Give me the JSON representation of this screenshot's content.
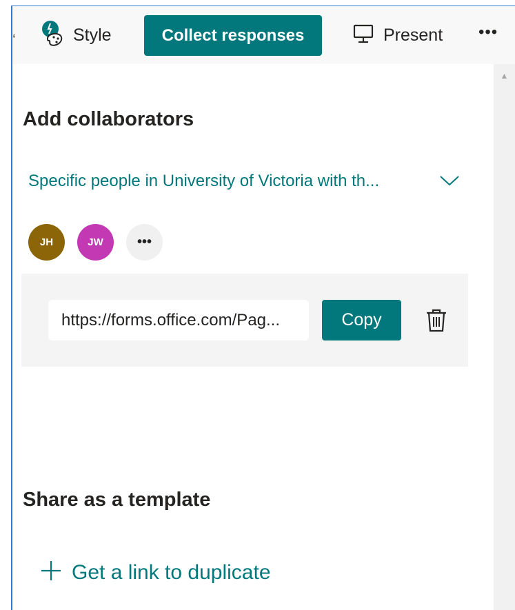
{
  "toolbar": {
    "style_label": "Style",
    "collect_label": "Collect responses",
    "present_label": "Present",
    "more_label": "•••",
    "cut_glyph": "‘"
  },
  "collaborators": {
    "title": "Add collaborators",
    "permission_text": "Specific people in University of Victoria with th...",
    "avatars": [
      {
        "initials": "JH",
        "color": "#8b6508"
      },
      {
        "initials": "JW",
        "color": "#c239b3"
      }
    ],
    "more_label": "•••",
    "link_url": "https://forms.office.com/Pag...",
    "copy_label": "Copy"
  },
  "template": {
    "title": "Share as a template",
    "duplicate_label": "Get a link to duplicate"
  },
  "colors": {
    "accent": "#03787c",
    "text": "#252423"
  },
  "icons": {
    "style": "palette-icon",
    "present": "monitor-icon",
    "dropdown": "chevron-down-icon",
    "delete": "trash-icon",
    "add": "plus-icon"
  }
}
